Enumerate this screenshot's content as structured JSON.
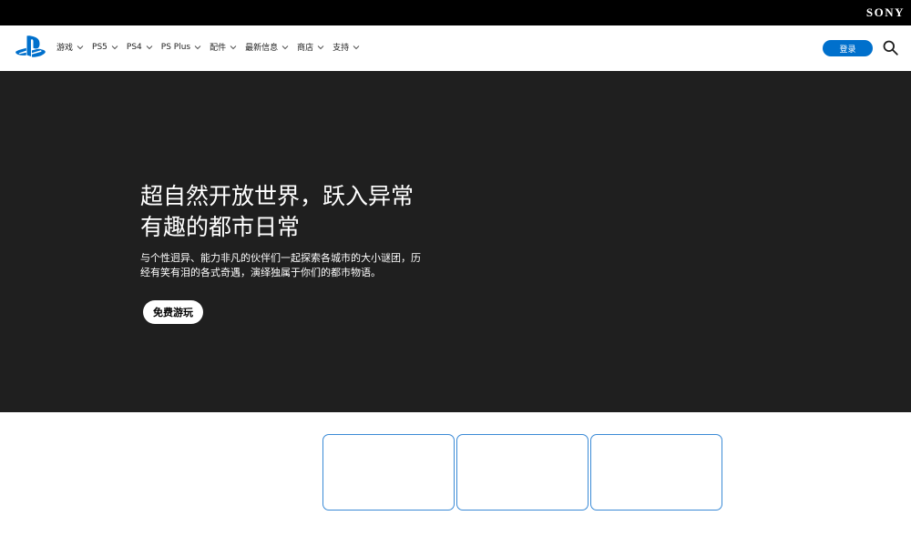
{
  "brand": {
    "sony_logo": "SONY"
  },
  "nav": {
    "items": [
      {
        "label": "游戏"
      },
      {
        "label": "PS5"
      },
      {
        "label": "PS4"
      },
      {
        "label": "PS Plus"
      },
      {
        "label": "配件"
      },
      {
        "label": "最新信息"
      },
      {
        "label": "商店"
      },
      {
        "label": "支持"
      }
    ],
    "login_label": "登录",
    "icons": {
      "logo": "playstation-logo-icon",
      "search": "search-icon",
      "chevron": "chevron-down-icon"
    }
  },
  "hero": {
    "title": "超自然开放世界，跃入异常有趣的都市日常",
    "description": "与个性迥异、能力非凡的伙伴们一起探索各城市的大小谜团，历经有笑有泪的各式奇遇，演绎独属于你们的都市物语。",
    "cta_label": "免费游玩"
  },
  "colors": {
    "top_bar": "#000000",
    "hero_bg": "#1f1f1f",
    "accent": "#0070cc",
    "tile_border": "#3a8ad6"
  },
  "tiles_count": 3
}
